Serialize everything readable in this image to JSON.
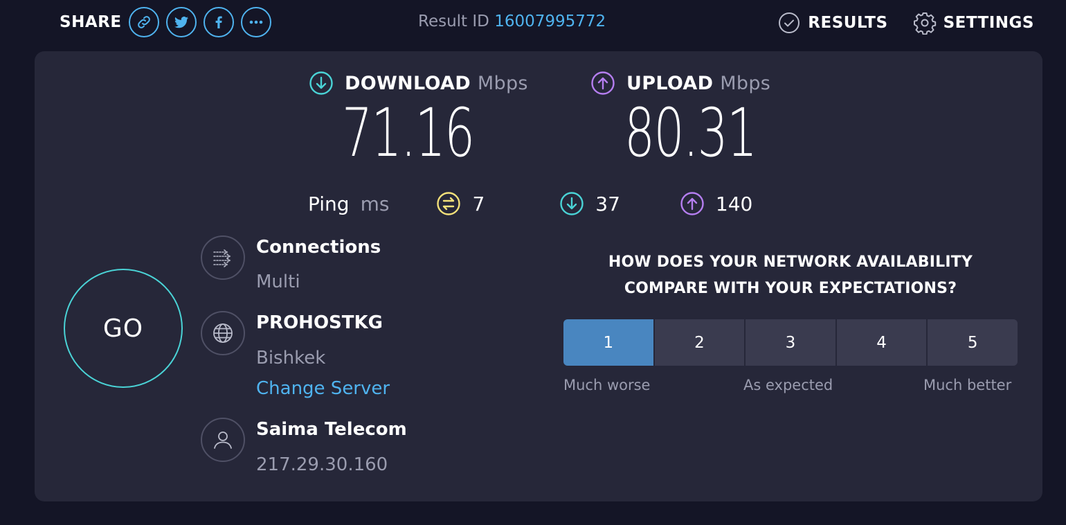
{
  "header": {
    "share_label": "SHARE",
    "share_buttons": [
      {
        "icon": "link-icon"
      },
      {
        "icon": "twitter-icon"
      },
      {
        "icon": "facebook-icon"
      },
      {
        "icon": "more-icon"
      }
    ],
    "result_id_label": "Result ID",
    "result_id": "16007995772",
    "results_label": "RESULTS",
    "settings_label": "SETTINGS"
  },
  "metrics": {
    "download_label": "DOWNLOAD",
    "download_unit": "Mbps",
    "download_value": "71.16",
    "upload_label": "UPLOAD",
    "upload_unit": "Mbps",
    "upload_value": "80.31",
    "ping_label": "Ping",
    "ping_unit": "ms",
    "ping_idle": "7",
    "ping_download": "37",
    "ping_upload": "140"
  },
  "go_label": "GO",
  "connections": {
    "title": "Connections",
    "value": "Multi"
  },
  "server": {
    "name": "PROHOSTKG",
    "location": "Bishkek",
    "change_label": "Change Server"
  },
  "provider": {
    "name": "Saima Telecom",
    "ip": "217.29.30.160"
  },
  "survey": {
    "question_line1": "HOW DOES YOUR NETWORK AVAILABILITY",
    "question_line2": "COMPARE WITH YOUR EXPECTATIONS?",
    "options": [
      "1",
      "2",
      "3",
      "4",
      "5"
    ],
    "selected": "1",
    "label_low": "Much worse",
    "label_mid": "As expected",
    "label_high": "Much better"
  },
  "colors": {
    "background": "#141526",
    "panel": "#262739",
    "accent_blue": "#4fb3ef",
    "download_cyan": "#4ad3d6",
    "upload_purple": "#b57ef0",
    "ping_yellow": "#f5e27a",
    "selected_rating": "#4986c0"
  }
}
